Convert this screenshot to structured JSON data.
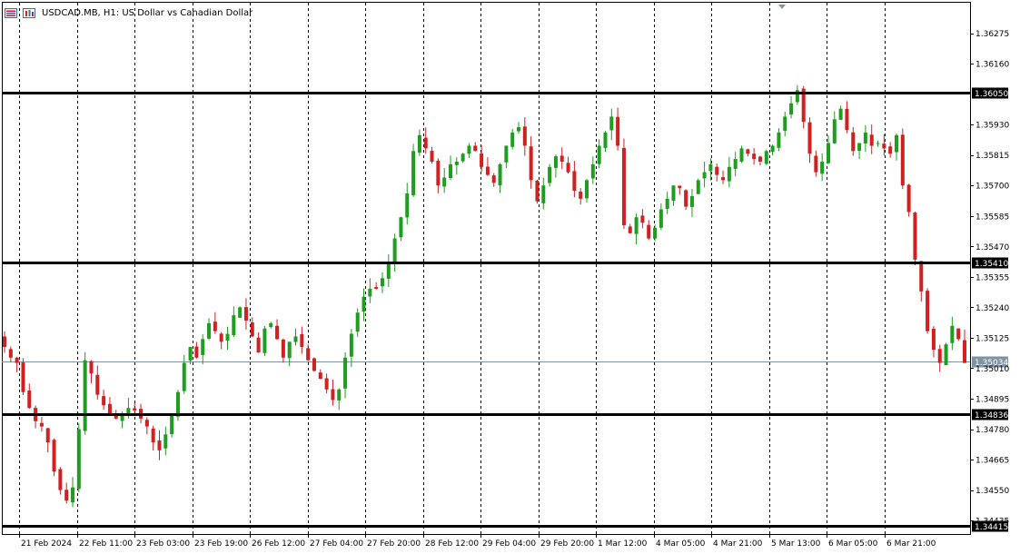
{
  "header": {
    "symbol_title": "USDCAD.MB, H1:  US Dollar vs Canadian Dollar"
  },
  "icons": [
    "chart-type-icon",
    "timeframe-icon",
    "shift-marker-icon"
  ],
  "colors": {
    "background": "#ffffff",
    "bull_candle": "#1e9e1e",
    "bear_candle": "#d21f1f",
    "grid": "#000000",
    "level_line": "#000000",
    "bid_line": "#7f93a3"
  },
  "chart_data": {
    "type": "candlestick",
    "symbol": "USDCAD.MB",
    "timeframe": "H1",
    "ylim": [
      1.34384,
      1.3639
    ],
    "price_ticks": [
      "1.36275",
      "1.36160",
      "1.35930",
      "1.35815",
      "1.35700",
      "1.35585",
      "1.35470",
      "1.35355",
      "1.35240",
      "1.35125",
      "1.35010",
      "1.34895",
      "1.34780",
      "1.34665",
      "1.34550",
      "1.34435"
    ],
    "time_labels": [
      "21 Feb 2024",
      "22 Feb 11:00",
      "23 Feb 03:00",
      "23 Feb 19:00",
      "26 Feb 12:00",
      "27 Feb 04:00",
      "27 Feb 20:00",
      "28 Feb 12:00",
      "29 Feb 04:00",
      "29 Feb 20:00",
      "1 Mar 12:00",
      "4 Mar 05:00",
      "4 Mar 21:00",
      "5 Mar 13:00",
      "6 Mar 05:00",
      "6 Mar 21:00"
    ],
    "horizontal_levels": [
      "1.36050",
      "1.35410",
      "1.34836",
      "1.34415"
    ],
    "bid_price": "1.35034",
    "grid": "vertical-dashed",
    "close_path": [
      1.3509,
      1.3505,
      1.3503,
      1.3492,
      1.3486,
      1.3481,
      1.3479,
      1.3473,
      1.3462,
      1.3455,
      1.3451,
      1.3456,
      1.3478,
      1.3504,
      1.3499,
      1.3491,
      1.3487,
      1.3484,
      1.3482,
      1.3483,
      1.3486,
      1.3485,
      1.3482,
      1.3479,
      1.3473,
      1.347,
      1.3476,
      1.3483,
      1.3492,
      1.3503,
      1.3509,
      1.3505,
      1.3512,
      1.3518,
      1.3515,
      1.3511,
      1.3514,
      1.3521,
      1.3524,
      1.3519,
      1.3513,
      1.3507,
      1.3516,
      1.3518,
      1.3512,
      1.3505,
      1.3511,
      1.3513,
      1.3509,
      1.3504,
      1.35,
      1.3497,
      1.3493,
      1.3489,
      1.3493,
      1.3505,
      1.3514,
      1.3522,
      1.3528,
      1.3531,
      1.3531,
      1.3535,
      1.3541,
      1.355,
      1.3558,
      1.3567,
      1.3583,
      1.3589,
      1.3584,
      1.3579,
      1.357,
      1.3573,
      1.3578,
      1.3579,
      1.3582,
      1.3585,
      1.3583,
      1.3577,
      1.3574,
      1.3571,
      1.3578,
      1.3585,
      1.359,
      1.3592,
      1.3585,
      1.3572,
      1.3564,
      1.357,
      1.3577,
      1.3581,
      1.3579,
      1.3575,
      1.3568,
      1.3565,
      1.3572,
      1.3578,
      1.3585,
      1.359,
      1.3596,
      1.3585,
      1.3555,
      1.3552,
      1.3558,
      1.3556,
      1.355,
      1.3554,
      1.3561,
      1.3565,
      1.357,
      1.3569,
      1.3562,
      1.3566,
      1.3572,
      1.3575,
      1.3578,
      1.3574,
      1.3572,
      1.3577,
      1.358,
      1.3584,
      1.3582,
      1.358,
      1.3579,
      1.3583,
      1.3585,
      1.359,
      1.3596,
      1.3601,
      1.3606,
      1.3594,
      1.3582,
      1.3575,
      1.3579,
      1.3586,
      1.3595,
      1.3599,
      1.3591,
      1.3583,
      1.3586,
      1.359,
      1.3585,
      1.3586,
      1.3584,
      1.3582,
      1.3589,
      1.357,
      1.356,
      1.3542,
      1.353,
      1.3515,
      1.3508,
      1.3503,
      1.351,
      1.3517,
      1.3512,
      1.3503
    ]
  }
}
